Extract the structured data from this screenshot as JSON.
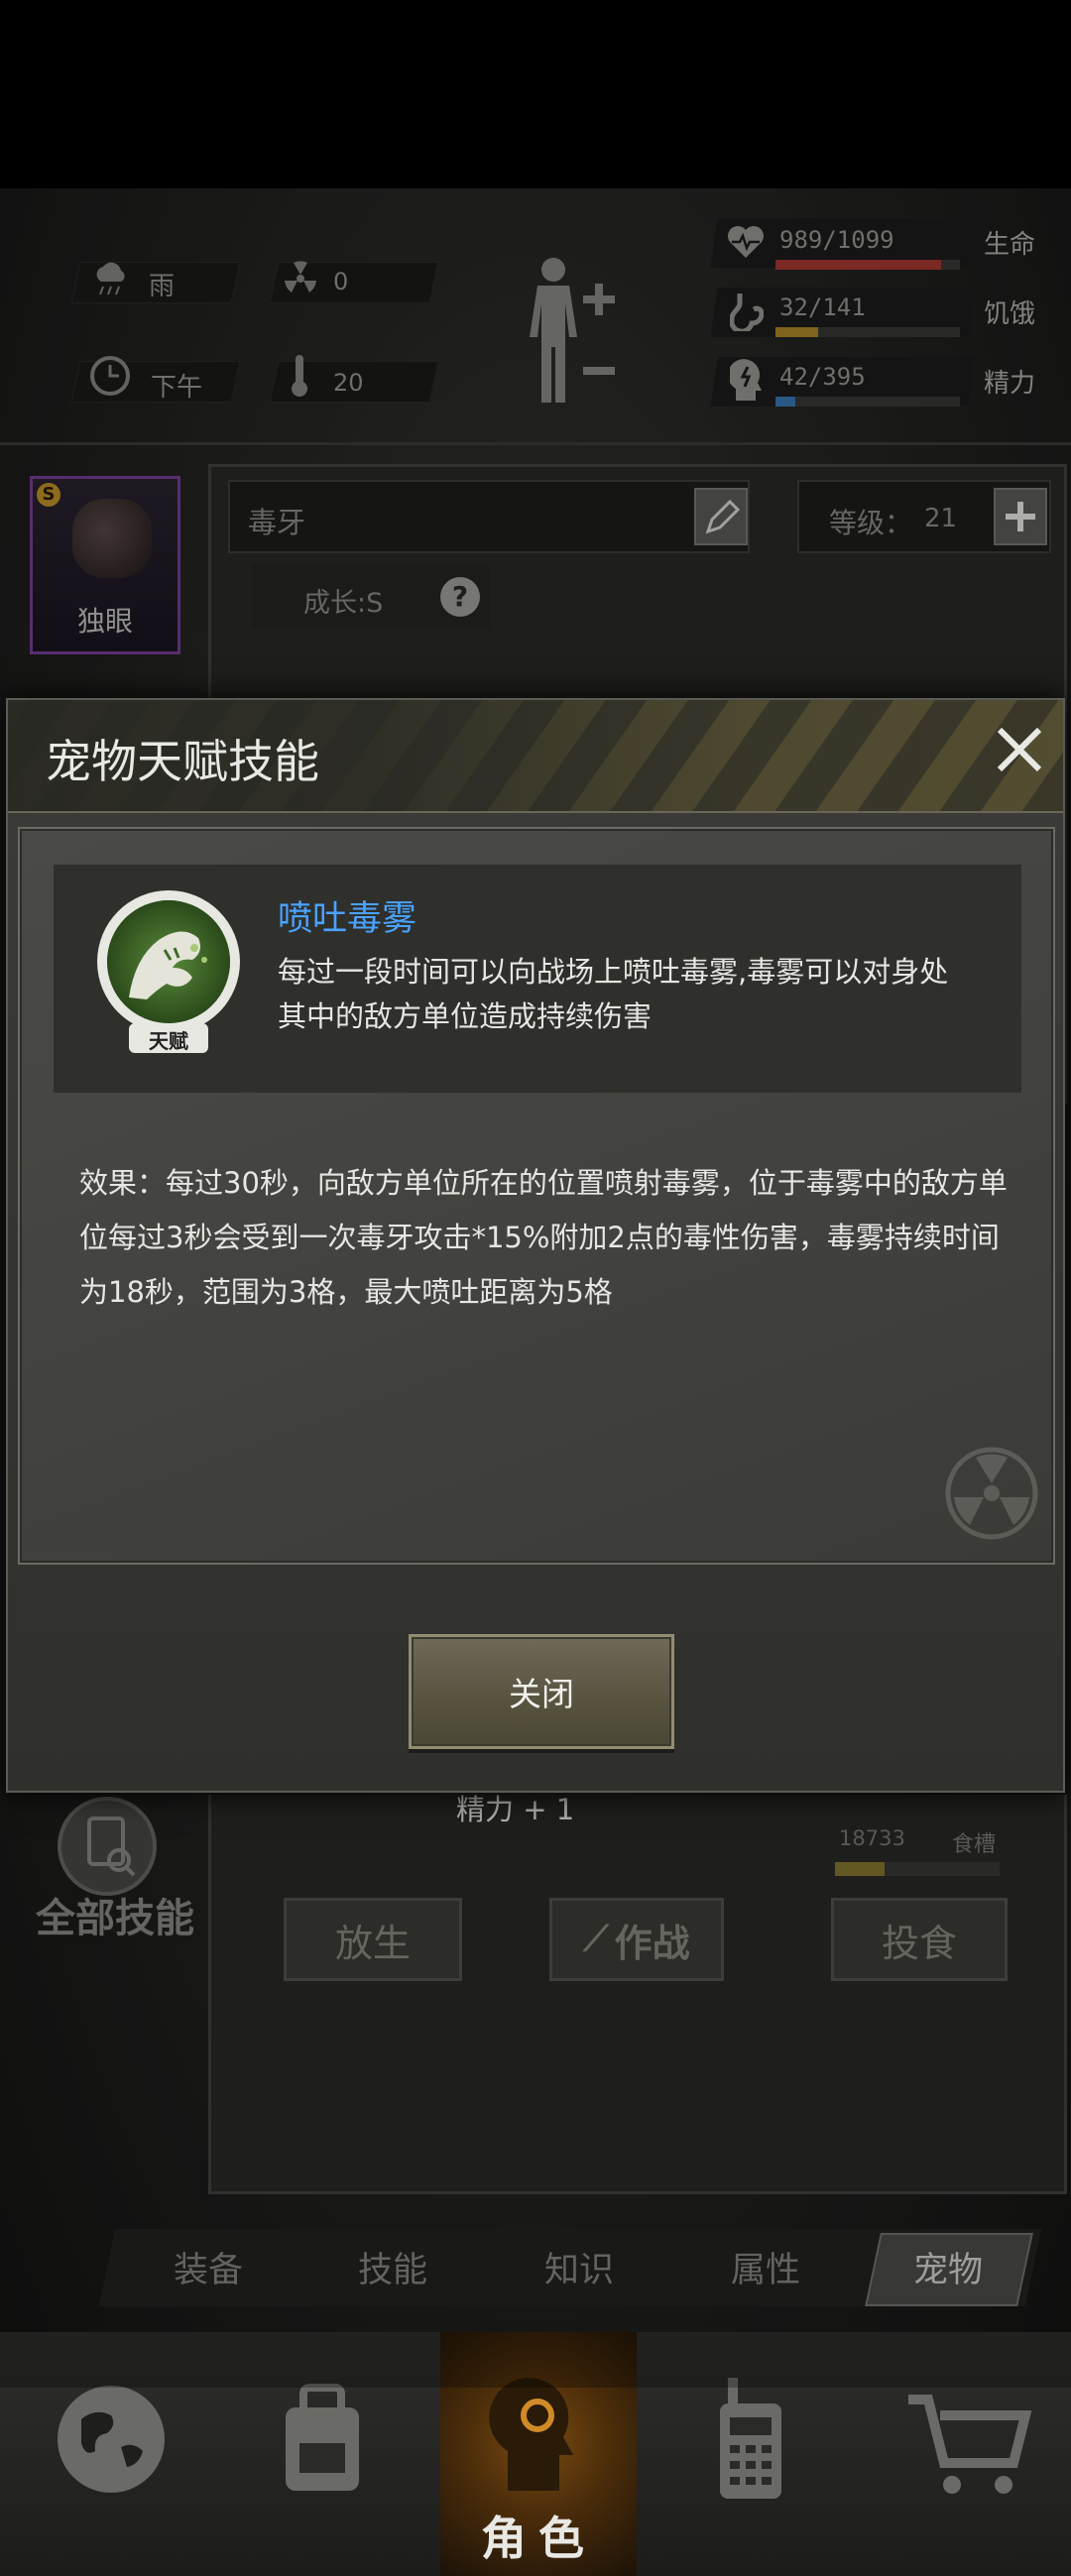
{
  "status": {
    "weather": "雨",
    "radiation": "0",
    "time_of_day": "下午",
    "temperature": "20",
    "health": {
      "value": "989/1099",
      "label": "生命",
      "fill": 0.9,
      "color": "#a93a32"
    },
    "hunger": {
      "value": "32/141",
      "label": "饥饿",
      "fill": 0.23,
      "color": "#b08b2a"
    },
    "energy": {
      "value": "42/395",
      "label": "精力",
      "fill": 0.11,
      "color": "#3a7ab8"
    }
  },
  "pet": {
    "name": "独眼",
    "badge": "S",
    "name_field": "毒牙",
    "level_label": "等级：",
    "level": "21",
    "growth": "成长:S",
    "growth_help": "?"
  },
  "dialog": {
    "title": "宠物天赋技能",
    "skill_badge": "天赋",
    "skill_name": "喷吐毒雾",
    "skill_desc": "每过一段时间可以向战场上喷吐毒雾,毒雾可以对身处其中的敌方单位造成持续伤害",
    "effect": "效果：每过30秒，向敌方单位所在的位置喷射毒雾，位于毒雾中的敌方单位每过3秒会受到一次毒牙攻击*15%附加2点的毒性伤害，毒雾持续时间为18秒，范围为3格，最大喷吐距离为5格",
    "close_button": "关闭"
  },
  "lower": {
    "energy_bonus": "精力 + 1",
    "food_value": "18733",
    "food_label": "食槽",
    "food_fill": 0.3,
    "all_skills": "全部技能",
    "release_button": "放生",
    "battle_button": "作战",
    "feed_button": "投食"
  },
  "tabs": [
    "装备",
    "技能",
    "知识",
    "属性",
    "宠物"
  ],
  "active_tab": "宠物",
  "bottom_nav": {
    "character_label": "角色"
  }
}
